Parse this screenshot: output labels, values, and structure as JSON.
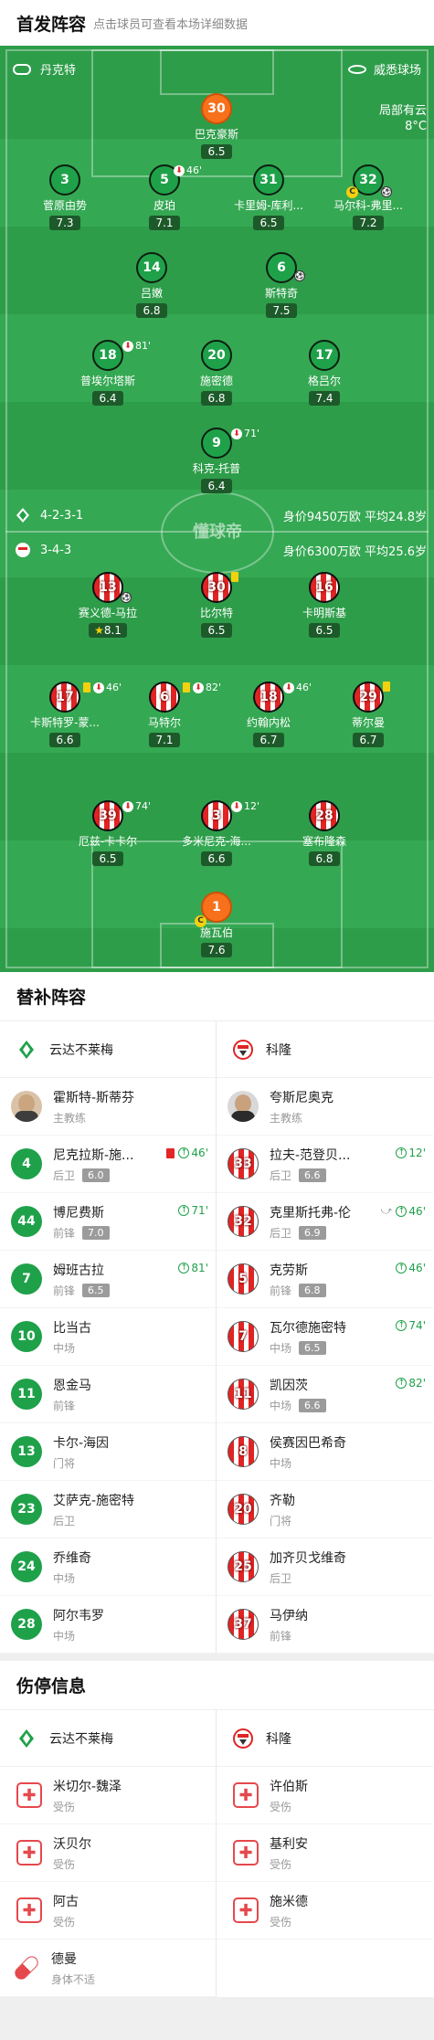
{
  "lineup": {
    "title": "首发阵容",
    "subtitle": "点击球员可查看本场详细数据"
  },
  "pitch_header": {
    "home_coach": "丹克特",
    "venue": "威悉球场",
    "weather_label": "局部有云",
    "temp": "8°C"
  },
  "home": {
    "formation": "4-2-3-1",
    "value": "身价9450万欧 平均24.8岁"
  },
  "away": {
    "formation": "3-4-3",
    "value": "身价6300万欧 平均25.6岁"
  },
  "watermark": "懂球帝",
  "home_players": [
    {
      "num": "30",
      "name": "巴克豪斯",
      "rating": "6.5",
      "kit": "o"
    },
    {
      "num": "3",
      "name": "菅原由势",
      "rating": "7.3",
      "kit": "g"
    },
    {
      "num": "5",
      "name": "皮珀",
      "rating": "7.1",
      "kit": "g",
      "sub": "46'"
    },
    {
      "num": "31",
      "name": "卡里姆-库利...",
      "rating": "6.5",
      "kit": "g"
    },
    {
      "num": "32",
      "name": "马尔科-弗里...",
      "rating": "7.2",
      "kit": "g"
    },
    {
      "num": "14",
      "name": "吕嫩",
      "rating": "6.8",
      "kit": "g"
    },
    {
      "num": "6",
      "name": "斯特奇",
      "rating": "7.5",
      "kit": "g"
    },
    {
      "num": "18",
      "name": "普埃尔塔斯",
      "rating": "6.4",
      "kit": "g",
      "sub": "81'"
    },
    {
      "num": "20",
      "name": "施密德",
      "rating": "6.8",
      "kit": "g"
    },
    {
      "num": "17",
      "name": "格吕尔",
      "rating": "7.4",
      "kit": "g"
    },
    {
      "num": "9",
      "name": "科克-托普",
      "rating": "6.4",
      "kit": "g",
      "sub": "71'"
    }
  ],
  "away_players": [
    {
      "num": "13",
      "name": "赛义德-马拉",
      "rating": "8.1",
      "kit": "r"
    },
    {
      "num": "30",
      "name": "比尔特",
      "rating": "6.5",
      "kit": "r"
    },
    {
      "num": "16",
      "name": "卡明斯基",
      "rating": "6.5",
      "kit": "r"
    },
    {
      "num": "17",
      "name": "卡斯特罗-蒙...",
      "rating": "6.6",
      "kit": "r",
      "sub": "46'"
    },
    {
      "num": "6",
      "name": "马特尔",
      "rating": "7.1",
      "kit": "r",
      "sub": "82'"
    },
    {
      "num": "18",
      "name": "约翰内松",
      "rating": "6.7",
      "kit": "r",
      "sub": "46'"
    },
    {
      "num": "29",
      "name": "蒂尔曼",
      "rating": "6.7",
      "kit": "r"
    },
    {
      "num": "39",
      "name": "厄兹-卡卡尔",
      "rating": "6.5",
      "kit": "r",
      "sub": "74'"
    },
    {
      "num": "3",
      "name": "多米尼克-海...",
      "rating": "6.6",
      "kit": "r",
      "sub": "12'"
    },
    {
      "num": "28",
      "name": "塞布隆森",
      "rating": "6.8",
      "kit": "r"
    },
    {
      "num": "1",
      "name": "施瓦伯",
      "rating": "7.6",
      "kit": "o"
    }
  ],
  "subs": {
    "title": "替补阵容",
    "home_team": "云达不莱梅",
    "away_team": "科隆",
    "home_coach": {
      "name": "霍斯特-斯蒂芬",
      "role": "主教练"
    },
    "away_coach": {
      "name": "夸斯尼奥克",
      "role": "主教练"
    },
    "home": [
      {
        "num": "4",
        "name": "尼克拉斯-施...",
        "pos": "后卫",
        "rating": "6.0",
        "evt": "46'",
        "card": true
      },
      {
        "num": "44",
        "name": "博尼费斯",
        "pos": "前锋",
        "rating": "7.0",
        "evt": "71'"
      },
      {
        "num": "7",
        "name": "姆班古拉",
        "pos": "前锋",
        "rating": "6.5",
        "evt": "81'"
      },
      {
        "num": "10",
        "name": "比当古",
        "pos": "中场"
      },
      {
        "num": "11",
        "name": "恩金马",
        "pos": "前锋"
      },
      {
        "num": "13",
        "name": "卡尔-海因",
        "pos": "门将"
      },
      {
        "num": "23",
        "name": "艾萨克-施密特",
        "pos": "后卫"
      },
      {
        "num": "24",
        "name": "乔维奇",
        "pos": "中场"
      },
      {
        "num": "28",
        "name": "阿尔韦罗",
        "pos": "中场"
      }
    ],
    "away": [
      {
        "num": "33",
        "name": "拉夫-范登贝...",
        "pos": "后卫",
        "rating": "6.6",
        "evt": "12'"
      },
      {
        "num": "32",
        "name": "克里斯托弗-伦",
        "pos": "后卫",
        "rating": "6.9",
        "evt": "46'",
        "assist": true
      },
      {
        "num": "5",
        "name": "克劳斯",
        "pos": "前锋",
        "rating": "6.8",
        "evt": "46'"
      },
      {
        "num": "7",
        "name": "瓦尔德施密特",
        "pos": "中场",
        "rating": "6.5",
        "evt": "74'"
      },
      {
        "num": "11",
        "name": "凯因茨",
        "pos": "中场",
        "rating": "6.6",
        "evt": "82'"
      },
      {
        "num": "8",
        "name": "侯赛因巴希奇",
        "pos": "中场"
      },
      {
        "num": "20",
        "name": "齐勒",
        "pos": "门将"
      },
      {
        "num": "25",
        "name": "加齐贝戈维奇",
        "pos": "后卫"
      },
      {
        "num": "37",
        "name": "马伊纳",
        "pos": "前锋"
      }
    ]
  },
  "injuries": {
    "title": "伤停信息",
    "home_team": "云达不莱梅",
    "away_team": "科隆",
    "home": [
      {
        "name": "米切尔-魏泽",
        "status": "受伤"
      },
      {
        "name": "沃贝尔",
        "status": "受伤"
      },
      {
        "name": "阿古",
        "status": "受伤"
      },
      {
        "name": "德曼",
        "status": "身体不适",
        "pill": true
      }
    ],
    "away": [
      {
        "name": "许伯斯",
        "status": "受伤"
      },
      {
        "name": "基利安",
        "status": "受伤"
      },
      {
        "name": "施米德",
        "status": "受伤"
      }
    ]
  }
}
